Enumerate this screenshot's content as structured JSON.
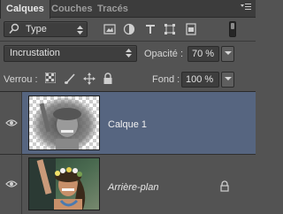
{
  "tabs": [
    {
      "label": "Calques",
      "active": true
    },
    {
      "label": "Couches",
      "active": false
    },
    {
      "label": "Tracés",
      "active": false
    }
  ],
  "panel_menu_icon": "panel-menu-icon",
  "filter": {
    "selected": "Type",
    "icons": [
      "image-filter-icon",
      "adjustment-filter-icon",
      "text-filter-icon",
      "shape-filter-icon",
      "smart-object-filter-icon"
    ],
    "toggle_icon": "filter-toggle-icon"
  },
  "blend": {
    "mode": "Incrustation",
    "opacity_label": "Opacité :",
    "opacity_value": "70 %"
  },
  "lock": {
    "label": "Verrou :",
    "icons": [
      "lock-transparency-icon",
      "lock-image-icon",
      "lock-position-icon",
      "lock-all-icon"
    ],
    "fill_label": "Fond :",
    "fill_value": "100 %"
  },
  "layers": [
    {
      "name": "Calque 1",
      "visible": true,
      "selected": true,
      "thumbnail": "grayscale-photo-with-transparency",
      "locked": false
    },
    {
      "name": "Arrière-plan",
      "visible": true,
      "selected": false,
      "thumbnail": "color-photo-woman-flower-crown",
      "locked": true
    }
  ],
  "colors": {
    "panel_bg": "#535353",
    "tabbar_bg": "#3c3c3c",
    "selected_layer_bg": "#566580",
    "field_bg": "#3e3e3e"
  }
}
